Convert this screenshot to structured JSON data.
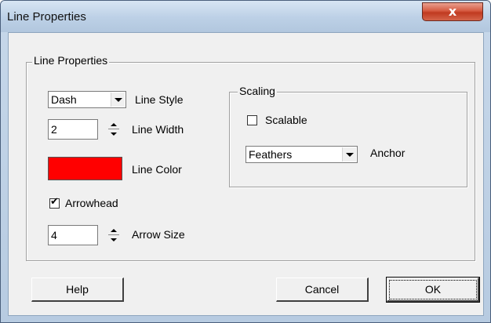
{
  "window": {
    "title": "Line Properties",
    "close_glyph": "x"
  },
  "group": {
    "legend": "Line Properties",
    "line_style": {
      "value": "Dash",
      "label": "Line Style"
    },
    "line_width": {
      "value": "2",
      "label": "Line Width"
    },
    "line_color": {
      "label": "Line Color",
      "color": "#ff0000"
    },
    "arrowhead": {
      "label": "Arrowhead",
      "checked": true
    },
    "arrow_size": {
      "value": "4",
      "label": "Arrow Size"
    }
  },
  "scaling": {
    "legend": "Scaling",
    "scalable": {
      "label": "Scalable",
      "checked": false
    },
    "anchor": {
      "value": "Feathers",
      "label": "Anchor"
    }
  },
  "buttons": {
    "help": "Help",
    "cancel": "Cancel",
    "ok": "OK"
  }
}
